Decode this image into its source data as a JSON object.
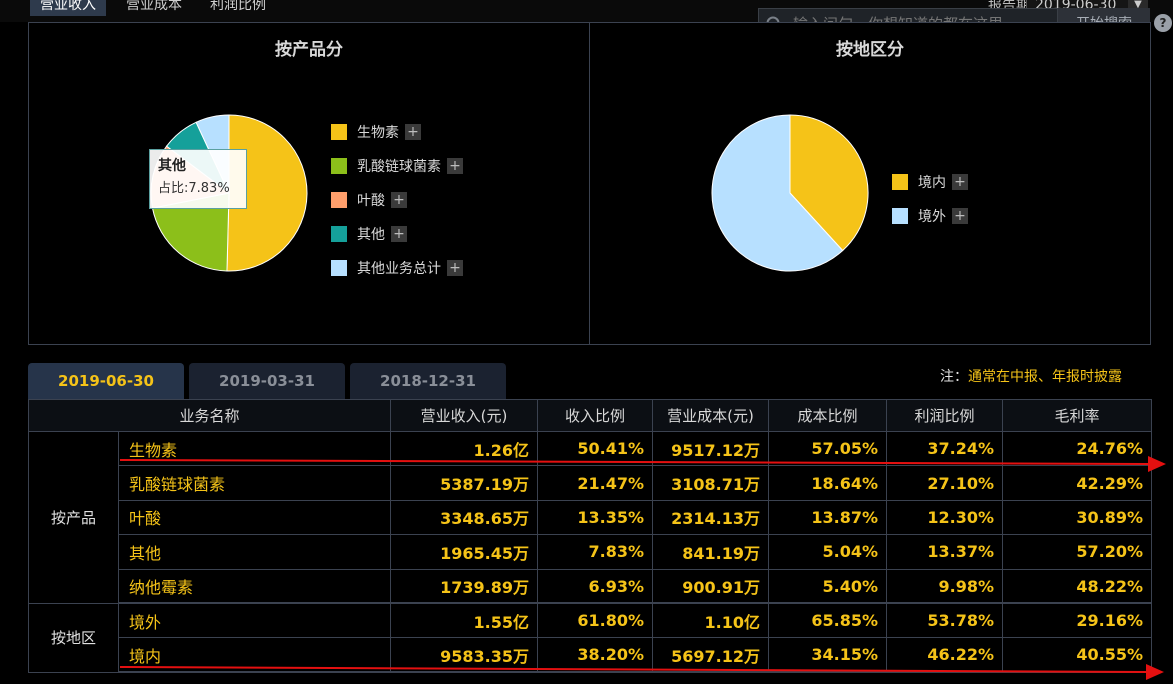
{
  "top": {
    "tabs": [
      "营业收入",
      "营业成本",
      "利润比例"
    ],
    "active_tab": 0,
    "period_label": "报告期",
    "period_value": "2019-06-30",
    "search_placeholder": "输入问句，你想知道的都在这里",
    "search_button": "开始搜索",
    "help": "?"
  },
  "charts": {
    "product": {
      "title": "按产品分",
      "legend": [
        {
          "label": "生物素",
          "color": "#f5c318"
        },
        {
          "label": "乳酸链球菌素",
          "color": "#8cbf1a"
        },
        {
          "label": "叶酸",
          "color": "#ff9e6b"
        },
        {
          "label": "其他",
          "color": "#15a09a"
        },
        {
          "label": "其他业务总计",
          "color": "#b7e0ff"
        }
      ],
      "tooltip": {
        "title": "其他",
        "value": "占比:7.83%"
      }
    },
    "region": {
      "title": "按地区分",
      "legend": [
        {
          "label": "境内",
          "color": "#f5c318"
        },
        {
          "label": "境外",
          "color": "#b7e0ff"
        }
      ]
    }
  },
  "chart_data": [
    {
      "type": "pie",
      "title": "按产品分",
      "labels": [
        "生物素",
        "乳酸链球菌素",
        "叶酸",
        "其他",
        "其他业务总计"
      ],
      "values": [
        50.41,
        21.47,
        13.35,
        7.83,
        6.93
      ],
      "colors": [
        "#f5c318",
        "#8cbf1a",
        "#ff9e6b",
        "#15a09a",
        "#b7e0ff"
      ]
    },
    {
      "type": "pie",
      "title": "按地区分",
      "labels": [
        "境内",
        "境外"
      ],
      "values": [
        38.2,
        61.8
      ],
      "colors": [
        "#f5c318",
        "#b7e0ff"
      ]
    }
  ],
  "date_tabs": [
    "2019-06-30",
    "2019-03-31",
    "2018-12-31"
  ],
  "note": {
    "prefix": "注：",
    "text": "通常在中报、年报时披露"
  },
  "table": {
    "headers": [
      "业务名称",
      "营业收入(元)",
      "收入比例",
      "营业成本(元)",
      "成本比例",
      "利润比例",
      "毛利率"
    ],
    "groups": [
      {
        "label": "按产品",
        "rows": [
          [
            "生物素",
            "1.26亿",
            "50.41%",
            "9517.12万",
            "57.05%",
            "37.24%",
            "24.76%"
          ],
          [
            "乳酸链球菌素",
            "5387.19万",
            "21.47%",
            "3108.71万",
            "18.64%",
            "27.10%",
            "42.29%"
          ],
          [
            "叶酸",
            "3348.65万",
            "13.35%",
            "2314.13万",
            "13.87%",
            "12.30%",
            "30.89%"
          ],
          [
            "其他",
            "1965.45万",
            "7.83%",
            "841.19万",
            "5.04%",
            "13.37%",
            "57.20%"
          ],
          [
            "纳他霉素",
            "1739.89万",
            "6.93%",
            "900.91万",
            "5.40%",
            "9.98%",
            "48.22%"
          ]
        ]
      },
      {
        "label": "按地区",
        "rows": [
          [
            "境外",
            "1.55亿",
            "61.80%",
            "1.10亿",
            "65.85%",
            "53.78%",
            "29.16%"
          ],
          [
            "境内",
            "9583.35万",
            "38.20%",
            "5697.12万",
            "34.15%",
            "46.22%",
            "40.55%"
          ]
        ]
      }
    ]
  }
}
